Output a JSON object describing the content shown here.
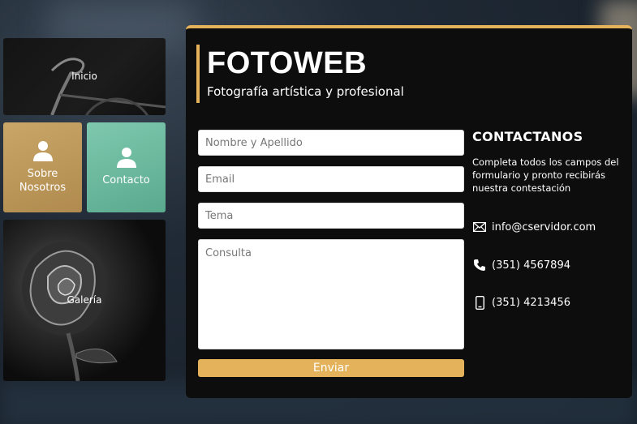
{
  "tiles": {
    "inicio": "Inicio",
    "sobre": [
      "Sobre",
      "Nosotros"
    ],
    "contacto": "Contacto",
    "galeria": "Galería"
  },
  "brand": {
    "title": "FOTOWEB",
    "subtitle": "Fotografía artística y profesional"
  },
  "form": {
    "name_placeholder": "Nombre y Apellido",
    "email_placeholder": "Email",
    "topic_placeholder": "Tema",
    "message_placeholder": "Consulta",
    "submit_label": "Enviar"
  },
  "contact": {
    "heading": "CONTACTANOS",
    "description": "Completa todos los campos del formulario y pronto recibirás nuestra contestación",
    "email": "info@cservidor.com",
    "phone": "(351) 4567894",
    "mobile": "(351) 4213456"
  },
  "colors": {
    "accent": "#e3b25a",
    "panel": "#0d0d0d",
    "sobre_tile": "#c9a768",
    "contacto_tile": "#7ec8ae"
  },
  "icons": [
    "user-icon",
    "mail-icon",
    "phone-icon",
    "mobile-icon"
  ]
}
